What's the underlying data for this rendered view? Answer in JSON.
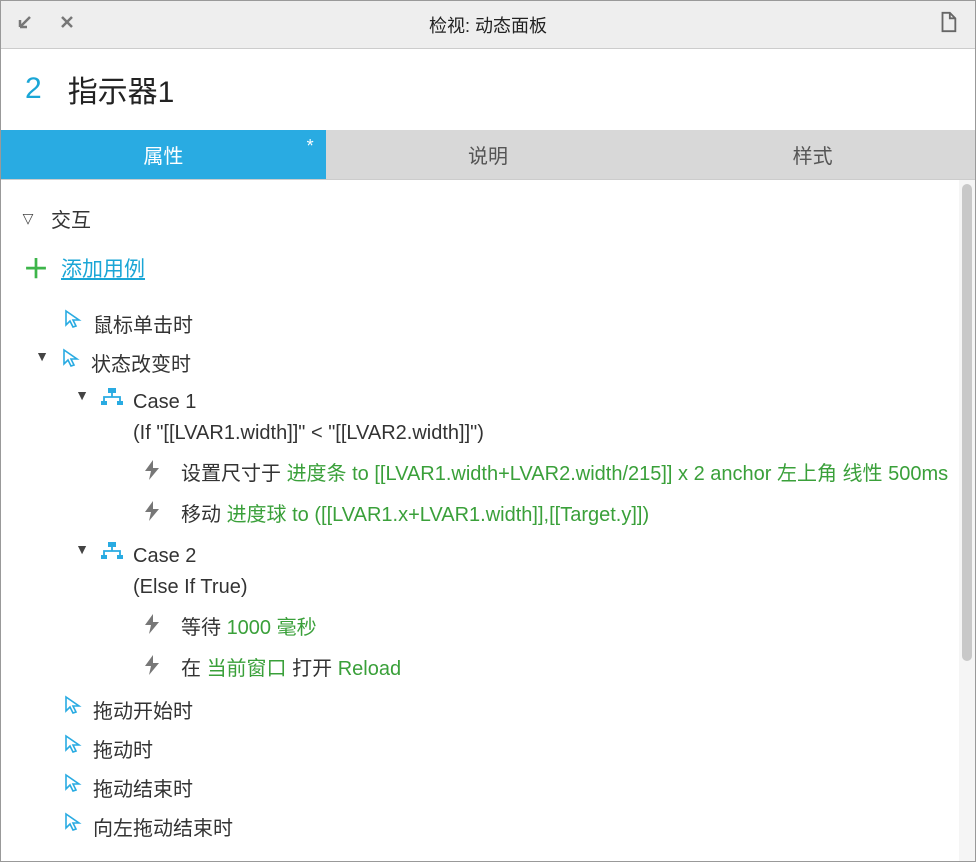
{
  "titlebar": {
    "title": "检视: 动态面板"
  },
  "header": {
    "count": "2",
    "name": "指示器1"
  },
  "tabs": {
    "properties": "属性",
    "dirty": "*",
    "description": "说明",
    "style": "样式"
  },
  "interactions": {
    "section_label": "交互",
    "add_case": "添加用例",
    "events": {
      "click": "鼠标单击时",
      "state_change": "状态改变时",
      "drag_start": "拖动开始时",
      "drag": "拖动时",
      "drag_end": "拖动结束时",
      "swipe_left_end": "向左拖动结束时"
    },
    "case1": {
      "name": "Case 1",
      "condition": "(If \"[[LVAR1.width]]\" < \"[[LVAR2.width]]\")",
      "action1_pre": "设置尺寸于 ",
      "action1_green": "进度条 to [[LVAR1.width+LVAR2.width/215]] x 2 anchor 左上角 线性 500ms",
      "action2_pre": "移动 ",
      "action2_green": "进度球 to ([[LVAR1.x+LVAR1.width]],[[Target.y]])"
    },
    "case2": {
      "name": "Case 2",
      "condition": "(Else If True)",
      "action1_pre": "等待 ",
      "action1_green": "1000 毫秒",
      "action2_pre1": "在 ",
      "action2_green1": "当前窗口",
      "action2_mid": " 打开 ",
      "action2_green2": "Reload"
    }
  }
}
